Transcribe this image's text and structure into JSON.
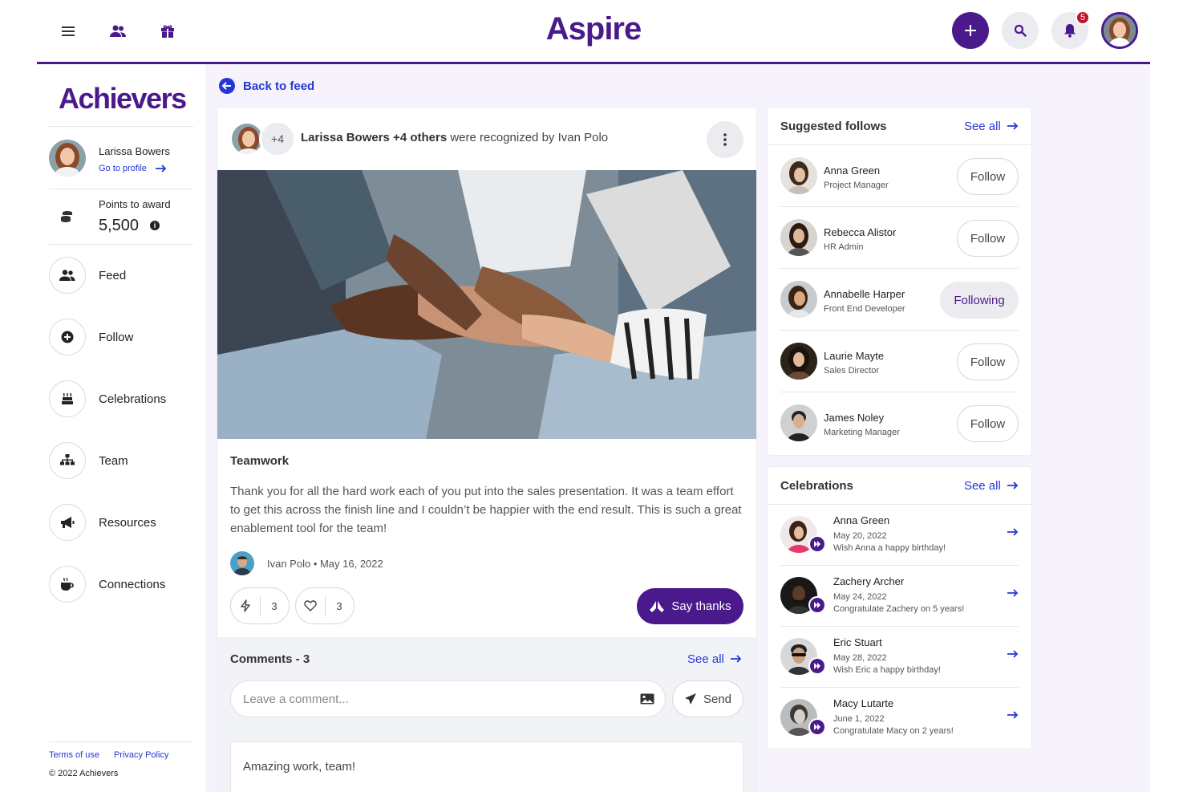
{
  "app": {
    "brand": "Aspire",
    "accent": "#4a1a8c",
    "link": "#2438d6",
    "notification_count": "5"
  },
  "sidebar": {
    "logo": "Achievers",
    "profile": {
      "name": "Larissa Bowers",
      "link": "Go to profile"
    },
    "points": {
      "label": "Points to award",
      "value": "5,500"
    },
    "items": [
      {
        "label": "Feed",
        "icon": "people-icon"
      },
      {
        "label": "Follow",
        "icon": "plus-circle-icon"
      },
      {
        "label": "Celebrations",
        "icon": "cake-icon"
      },
      {
        "label": "Team",
        "icon": "org-chart-icon"
      },
      {
        "label": "Resources",
        "icon": "megaphone-icon"
      },
      {
        "label": "Connections",
        "icon": "coffee-icon"
      }
    ],
    "footer": {
      "terms": "Terms of use",
      "privacy": "Privacy Policy",
      "copyright": "© 2022 Achievers"
    }
  },
  "back_label": "Back to feed",
  "post": {
    "others": "+4",
    "header_bold": "Larissa Bowers +4 others",
    "header_rest": " were recognized by Ivan Polo",
    "title": "Teamwork",
    "body": "Thank you for all the hard work each of you put into the sales presentation. It was a team effort to get this across the finish line and I couldn’t be happier with the end result. This is such a great enablement tool for the team!",
    "author_line": "Ivan Polo • May 16, 2022",
    "boost_count": "3",
    "like_count": "3",
    "thanks_label": "Say thanks",
    "comments": {
      "title": "Comments - 3",
      "see_all": "See all",
      "placeholder": "Leave a comment...",
      "send": "Send",
      "first": "Amazing work, team!"
    }
  },
  "suggested": {
    "title": "Suggested follows",
    "see_all": "See all",
    "people": [
      {
        "name": "Anna Green",
        "role": "Project Manager",
        "action": "Follow"
      },
      {
        "name": "Rebecca Alistor",
        "role": "HR Admin",
        "action": "Follow"
      },
      {
        "name": "Annabelle Harper",
        "role": "Front End Developer",
        "action": "Following"
      },
      {
        "name": "Laurie Mayte",
        "role": "Sales Director",
        "action": "Follow"
      },
      {
        "name": "James Noley",
        "role": "Marketing Manager",
        "action": "Follow"
      }
    ]
  },
  "celebrations": {
    "title": "Celebrations",
    "see_all": "See all",
    "items": [
      {
        "name": "Anna Green",
        "date": "May 20, 2022",
        "message": "Wish Anna a happy birthday!"
      },
      {
        "name": "Zachery Archer",
        "date": "May 24, 2022",
        "message": "Congratulate Zachery on 5 years!"
      },
      {
        "name": "Eric Stuart",
        "date": "May 28, 2022",
        "message": "Wish Eric a happy birthday!"
      },
      {
        "name": "Macy Lutarte",
        "date": "June 1, 2022",
        "message": "Congratulate Macy on 2 years!"
      }
    ]
  }
}
